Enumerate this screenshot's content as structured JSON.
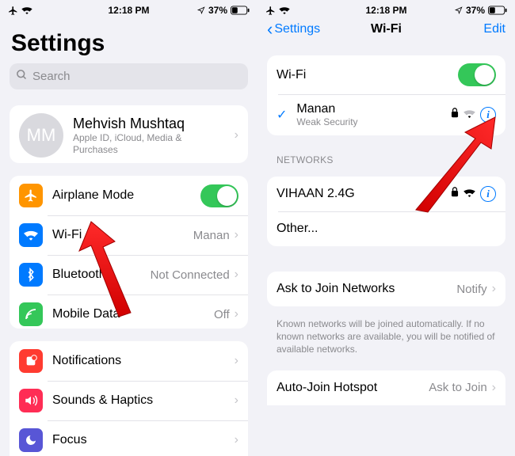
{
  "status": {
    "time": "12:18 PM",
    "battery": "37%"
  },
  "left": {
    "title": "Settings",
    "search_placeholder": "Search",
    "profile": {
      "initials": "MM",
      "name": "Mehvish Mushtaq",
      "detail": "Apple ID, iCloud, Media & Purchases"
    },
    "rows": {
      "airplane": "Airplane Mode",
      "wifi": "Wi-Fi",
      "wifi_value": "Manan",
      "bluetooth": "Bluetooth",
      "bluetooth_value": "Not Connected",
      "mobile": "Mobile Data",
      "mobile_value": "Off",
      "notifications": "Notifications",
      "sounds": "Sounds & Haptics",
      "focus": "Focus"
    }
  },
  "right": {
    "back": "Settings",
    "title": "Wi-Fi",
    "edit": "Edit",
    "wifi_label": "Wi-Fi",
    "connected": {
      "name": "Manan",
      "security": "Weak Security"
    },
    "networks_header": "NETWORKS",
    "networks": {
      "n0": "VIHAAN 2.4G",
      "other": "Other..."
    },
    "ask_label": "Ask to Join Networks",
    "ask_value": "Notify",
    "ask_footer": "Known networks will be joined automatically. If no known networks are available, you will be notified of available networks.",
    "hotspot_label": "Auto-Join Hotspot",
    "hotspot_value": "Ask to Join"
  }
}
